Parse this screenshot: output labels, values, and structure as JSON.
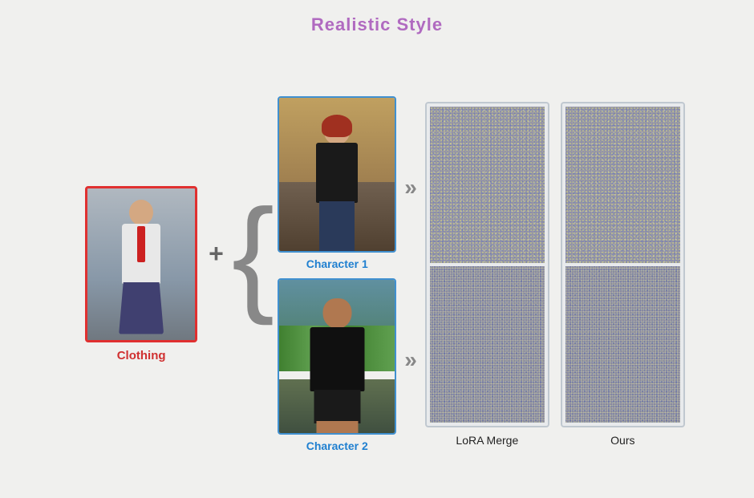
{
  "title": "Realistic Style",
  "clothing": {
    "label": "Clothing"
  },
  "characters": [
    {
      "label": "Character 1"
    },
    {
      "label": "Character 2"
    }
  ],
  "results": [
    {
      "label": "LoRA Merge"
    },
    {
      "label": "Ours"
    }
  ],
  "symbols": {
    "plus": "+",
    "bracket_open": "{",
    "arrow": "»"
  }
}
